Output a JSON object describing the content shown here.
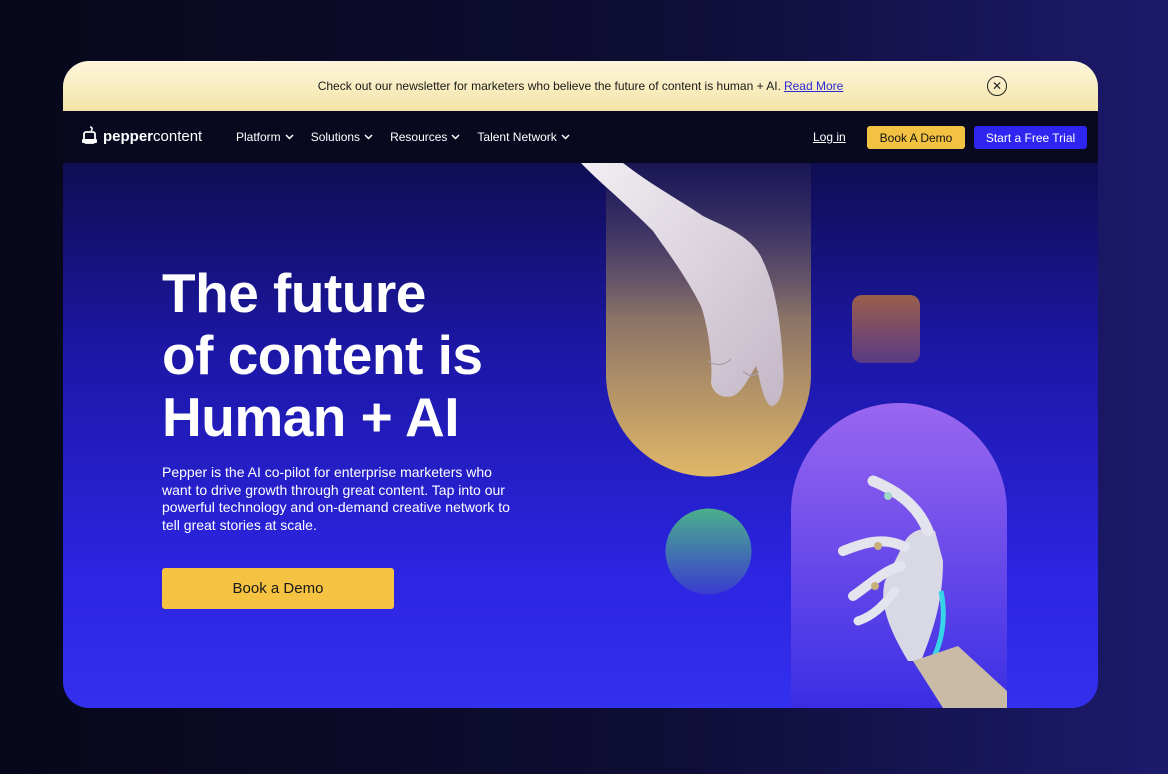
{
  "banner": {
    "text": "Check out our newsletter for marketers who believe the future of content is human + AI.",
    "link": "Read More",
    "close_icon": "close-icon"
  },
  "nav": {
    "logo_bold": "pepper",
    "logo_light": "content",
    "menu": [
      {
        "label": "Platform"
      },
      {
        "label": "Solutions"
      },
      {
        "label": "Resources"
      },
      {
        "label": "Talent Network"
      }
    ],
    "login": "Log in",
    "book_demo": "Book A Demo",
    "free_trial": "Start a Free Trial"
  },
  "hero": {
    "headline_lines": [
      "The future",
      "of content is",
      "Human + AI"
    ],
    "subtext": "Pepper is the AI co-pilot for enterprise marketers who want to drive growth through great content. Tap into our powerful technology and on-demand creative network to tell great stories at scale.",
    "cta": "Book a Demo"
  },
  "colors": {
    "accent_yellow": "#f4c243",
    "accent_blue": "#2f25f0",
    "banner_bg": "#fbf0c8"
  }
}
